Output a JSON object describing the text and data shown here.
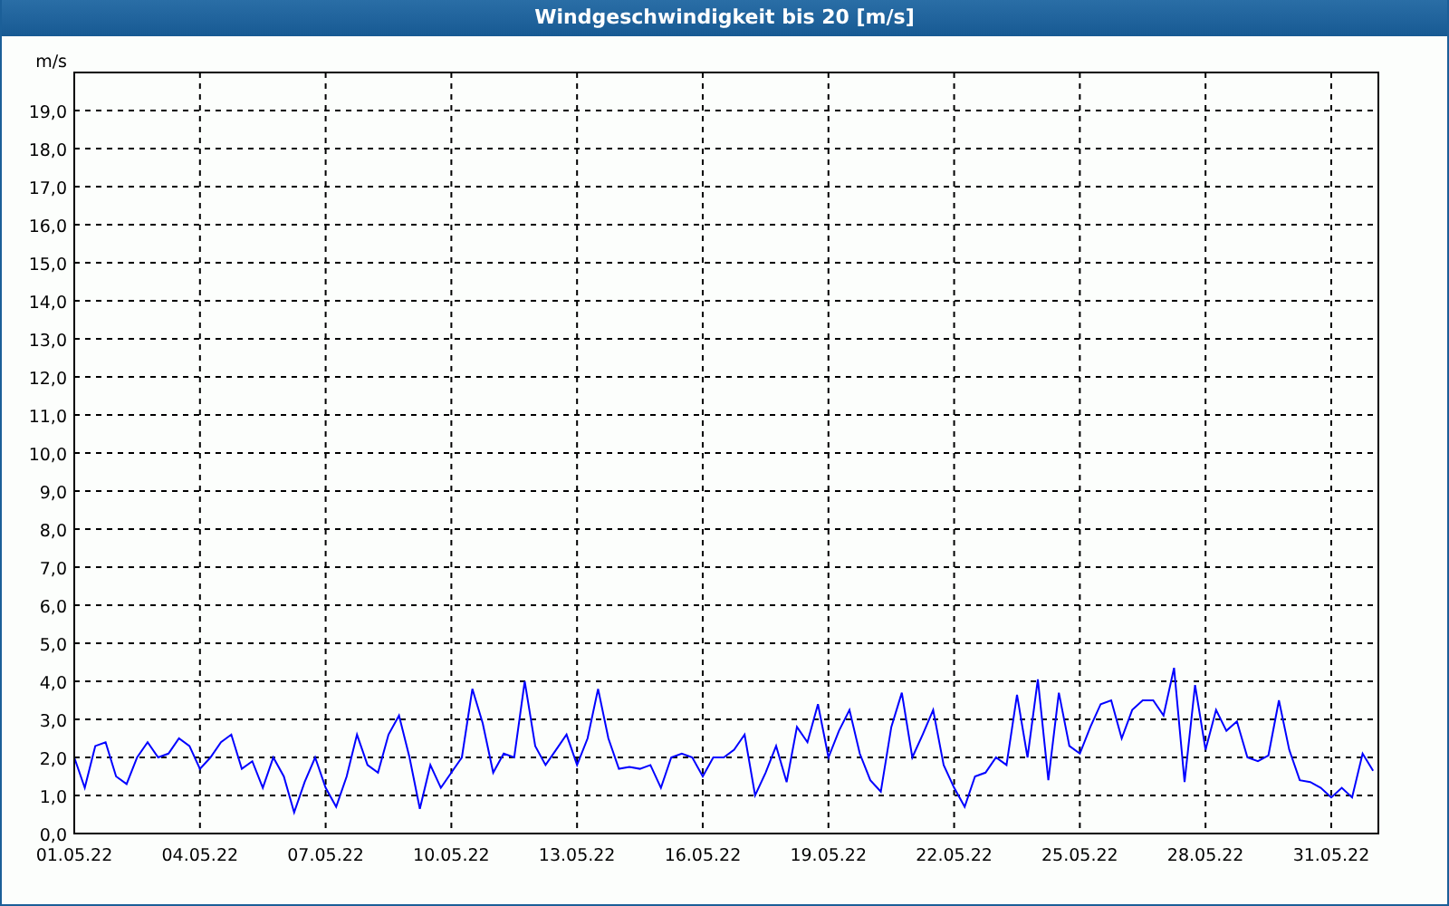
{
  "window": {
    "title": "Windgeschwindigkeit bis 20 [m/s]"
  },
  "chart": {
    "chart_data": {
      "type": "line",
      "ylabel": "m/s",
      "categories": [
        "01.05.22",
        null,
        null,
        null,
        null,
        null,
        null,
        null,
        null,
        null,
        null,
        null,
        "04.05.22",
        null,
        null,
        null,
        null,
        null,
        null,
        null,
        null,
        null,
        null,
        null,
        "07.05.22",
        null,
        null,
        null,
        null,
        null,
        null,
        null,
        null,
        null,
        null,
        null,
        "10.05.22",
        null,
        null,
        null,
        null,
        null,
        null,
        null,
        null,
        null,
        null,
        null,
        "13.05.22",
        null,
        null,
        null,
        null,
        null,
        null,
        null,
        null,
        null,
        null,
        null,
        "16.05.22",
        null,
        null,
        null,
        null,
        null,
        null,
        null,
        null,
        null,
        null,
        null,
        "19.05.22",
        null,
        null,
        null,
        null,
        null,
        null,
        null,
        null,
        null,
        null,
        null,
        "22.05.22",
        null,
        null,
        null,
        null,
        null,
        null,
        null,
        null,
        null,
        null,
        null,
        "25.05.22",
        null,
        null,
        null,
        null,
        null,
        null,
        null,
        null,
        null,
        null,
        null,
        "28.05.22",
        null,
        null,
        null,
        null,
        null,
        null,
        null,
        null,
        null,
        null,
        null,
        "31.05.22",
        null,
        null,
        null,
        null
      ],
      "series": [
        {
          "color": "#0000ff",
          "values": [
            2.0,
            1.2,
            2.3,
            2.4,
            1.5,
            1.3,
            2.0,
            2.4,
            2.0,
            2.1,
            2.5,
            2.3,
            1.7,
            2.0,
            2.4,
            2.6,
            1.7,
            1.9,
            1.2,
            2.0,
            1.5,
            0.55,
            1.35,
            2.0,
            1.2,
            0.7,
            1.5,
            2.6,
            1.8,
            1.6,
            2.6,
            3.1,
            2.0,
            0.65,
            1.8,
            1.2,
            1.6,
            2.0,
            3.8,
            2.9,
            1.6,
            2.1,
            2.0,
            4.0,
            2.3,
            1.8,
            2.2,
            2.6,
            1.8,
            2.5,
            3.8,
            2.5,
            1.7,
            1.75,
            1.7,
            1.8,
            1.2,
            2.0,
            2.1,
            2.0,
            1.5,
            2.0,
            2.0,
            2.2,
            2.6,
            1.0,
            1.6,
            2.3,
            1.35,
            2.8,
            2.4,
            3.4,
            2.0,
            2.7,
            3.25,
            2.1,
            1.4,
            1.1,
            2.8,
            3.7,
            2.0,
            2.6,
            3.25,
            1.8,
            1.2,
            0.7,
            1.5,
            1.6,
            2.0,
            1.8,
            3.65,
            2.0,
            4.05,
            1.4,
            3.7,
            2.3,
            2.1,
            2.8,
            3.4,
            3.5,
            2.5,
            3.25,
            3.5,
            3.5,
            3.1,
            4.35,
            1.35,
            3.9,
            2.2,
            3.25,
            2.7,
            2.95,
            2.0,
            1.9,
            2.05,
            3.5,
            2.2,
            1.4,
            1.35,
            1.2,
            0.95,
            1.2,
            0.95,
            2.1,
            1.65
          ]
        }
      ],
      "grid": true,
      "ylim": [
        0,
        20
      ],
      "yticks": [
        {
          "value": 0,
          "label": "0,0"
        },
        {
          "value": 1,
          "label": "1,0"
        },
        {
          "value": 2,
          "label": "2,0"
        },
        {
          "value": 3,
          "label": "3,0"
        },
        {
          "value": 4,
          "label": "4,0"
        },
        {
          "value": 5,
          "label": "5,0"
        },
        {
          "value": 6,
          "label": "6,0"
        },
        {
          "value": 7,
          "label": "7,0"
        },
        {
          "value": 8,
          "label": "8,0"
        },
        {
          "value": 9,
          "label": "9,0"
        },
        {
          "value": 10,
          "label": "10,0"
        },
        {
          "value": 11,
          "label": "11,0"
        },
        {
          "value": 12,
          "label": "12,0"
        },
        {
          "value": 13,
          "label": "13,0"
        },
        {
          "value": 14,
          "label": "14,0"
        },
        {
          "value": 15,
          "label": "15,0"
        },
        {
          "value": 16,
          "label": "16,0"
        },
        {
          "value": 17,
          "label": "17,0"
        },
        {
          "value": 18,
          "label": "18,0"
        },
        {
          "value": 19,
          "label": "19,0"
        }
      ]
    }
  }
}
